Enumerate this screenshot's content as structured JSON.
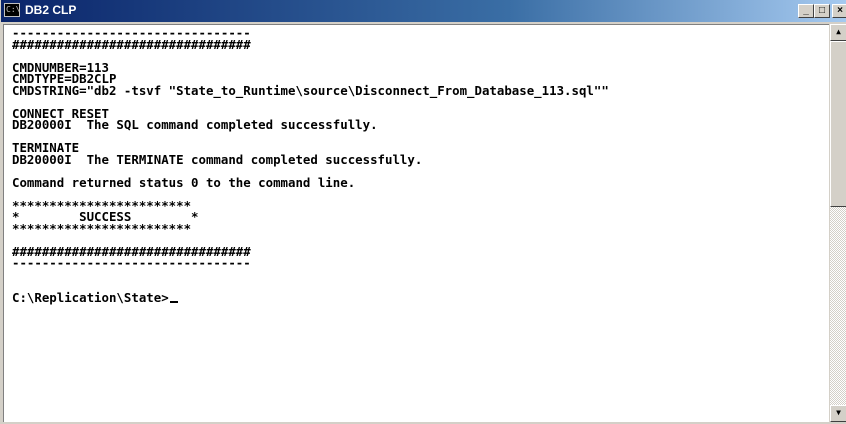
{
  "window": {
    "title": "DB2 CLP",
    "icon": "console-window-icon",
    "controls": {
      "minimize": "_",
      "maximize": "□",
      "close": "×"
    }
  },
  "console": {
    "lines": [
      "--------------------------------",
      "################################",
      "",
      "CMDNUMBER=113",
      "CMDTYPE=DB2CLP",
      "CMDSTRING=\"db2 -tsvf \"State_to_Runtime\\source\\Disconnect_From_Database_113.sql\"\"",
      "",
      "CONNECT RESET",
      "DB20000I  The SQL command completed successfully.",
      "",
      "TERMINATE",
      "DB20000I  The TERMINATE command completed successfully.",
      "",
      "Command returned status 0 to the command line.",
      "",
      "************************",
      "*        SUCCESS        *",
      "************************",
      "",
      "################################",
      "--------------------------------",
      "",
      "",
      "C:\\Replication\\State>"
    ]
  },
  "scrollbar": {
    "up_arrow": "▲",
    "down_arrow": "▼"
  }
}
